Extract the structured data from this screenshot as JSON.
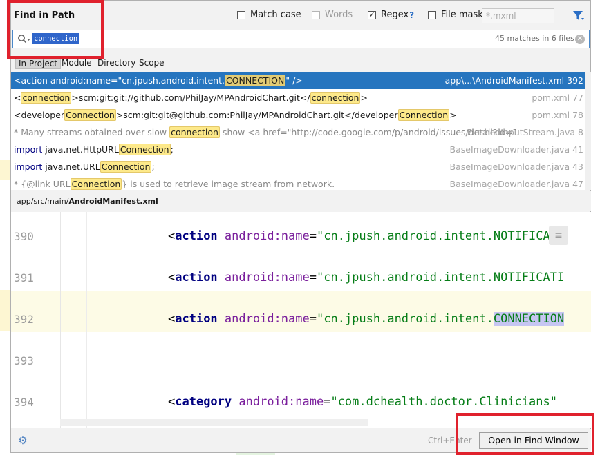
{
  "dialog": {
    "title": "Find in Path",
    "options": {
      "match_case": {
        "label": "Match case",
        "checked": false
      },
      "words": {
        "label": "Words",
        "checked": false,
        "enabled": false
      },
      "regex": {
        "label": "Regex",
        "help": "?",
        "checked": true
      },
      "file_mask": {
        "label": "File mask:",
        "checked": false,
        "placeholder": "*.mxml"
      }
    },
    "filter_icon": "filter-icon"
  },
  "search": {
    "value": "connection",
    "match_count": "45 matches in 6 files",
    "clear_icon": "clear-icon"
  },
  "scopes": [
    "In Project",
    "Module",
    "Directory",
    "Scope"
  ],
  "results": [
    {
      "parts": [
        [
          "",
          "<action android:name=\"cn.jpush.android.intent."
        ],
        [
          "hl",
          "CONNECTION"
        ],
        [
          "",
          "\" />"
        ]
      ],
      "file": "app\\...\\AndroidManifest.xml 392",
      "selected": true
    },
    {
      "parts": [
        [
          "",
          "<"
        ],
        [
          "hl",
          "connection"
        ],
        [
          "",
          ">scm:git:git://github.com/PhilJay/MPAndroidChart.git</"
        ],
        [
          "hl",
          "connection"
        ],
        [
          "",
          ">"
        ]
      ],
      "file": "pom.xml 77"
    },
    {
      "parts": [
        [
          "",
          "<developer"
        ],
        [
          "hl",
          "Connection"
        ],
        [
          "",
          ">scm:git:git@github.com:PhilJay/MPAndroidChart.git</developer"
        ],
        [
          "hl",
          "Connection"
        ],
        [
          "",
          ">"
        ]
      ],
      "file": "pom.xml 78"
    },
    {
      "parts": [
        [
          "gray",
          "* Many streams obtained over slow "
        ],
        [
          "hl",
          "connection"
        ],
        [
          "gray",
          " show <a href=\"http://code.google.com/p/android/issues/detail?id=1"
        ]
      ],
      "file": "FlushedInputStream.java 8"
    },
    {
      "parts": [
        [
          "kw",
          "import "
        ],
        [
          "",
          "java.net.HttpURL"
        ],
        [
          "hl",
          "Connection"
        ],
        [
          "",
          ";"
        ]
      ],
      "file": "BaseImageDownloader.java 41"
    },
    {
      "parts": [
        [
          "kw",
          "import "
        ],
        [
          "",
          "java.net.URL"
        ],
        [
          "hl",
          "Connection"
        ],
        [
          "",
          ";"
        ]
      ],
      "file": "BaseImageDownloader.java 43"
    },
    {
      "parts": [
        [
          "gray",
          "* {@link URL"
        ],
        [
          "hl",
          "Connection"
        ],
        [
          "gray",
          "} is used to retrieve image stream from network."
        ]
      ],
      "file": "BaseImageDownloader.java 47"
    }
  ],
  "preview": {
    "path_prefix": "app/src/main/",
    "path_file": "AndroidManifest.xml",
    "lines": [
      {
        "num": "390",
        "tokens": [
          [
            "c-plain",
            "<"
          ],
          [
            "c-tag",
            "action "
          ],
          [
            "c-attr",
            "android:name"
          ],
          [
            "c-plain",
            "="
          ],
          [
            "c-str",
            "\"cn.jpush.android.intent.NOTIFICATI"
          ]
        ]
      },
      {
        "num": "391",
        "tokens": [
          [
            "c-plain",
            "<"
          ],
          [
            "c-tag",
            "action "
          ],
          [
            "c-attr",
            "android:name"
          ],
          [
            "c-plain",
            "="
          ],
          [
            "c-str",
            "\"cn.jpush.android.intent.NOTIFICATI"
          ]
        ]
      },
      {
        "num": "392",
        "tokens": [
          [
            "c-plain",
            "<"
          ],
          [
            "c-tag",
            "action "
          ],
          [
            "c-attr",
            "android:name"
          ],
          [
            "c-plain",
            "="
          ],
          [
            "c-str",
            "\"cn.jpush.android.intent."
          ],
          [
            "c-str sel-match",
            "CONNECTION"
          ]
        ]
      },
      {
        "num": "393",
        "tokens": []
      },
      {
        "num": "394",
        "tokens": [
          [
            "c-plain",
            "<"
          ],
          [
            "c-tag",
            "category "
          ],
          [
            "c-attr",
            "android:name"
          ],
          [
            "c-plain",
            "="
          ],
          [
            "c-str",
            "\"com.dchealth.doctor.Clinicians\""
          ]
        ]
      }
    ]
  },
  "footer": {
    "shortcut": "Ctrl+Enter",
    "open_button": "Open in Find Window",
    "settings_icon": "settings-icon"
  }
}
